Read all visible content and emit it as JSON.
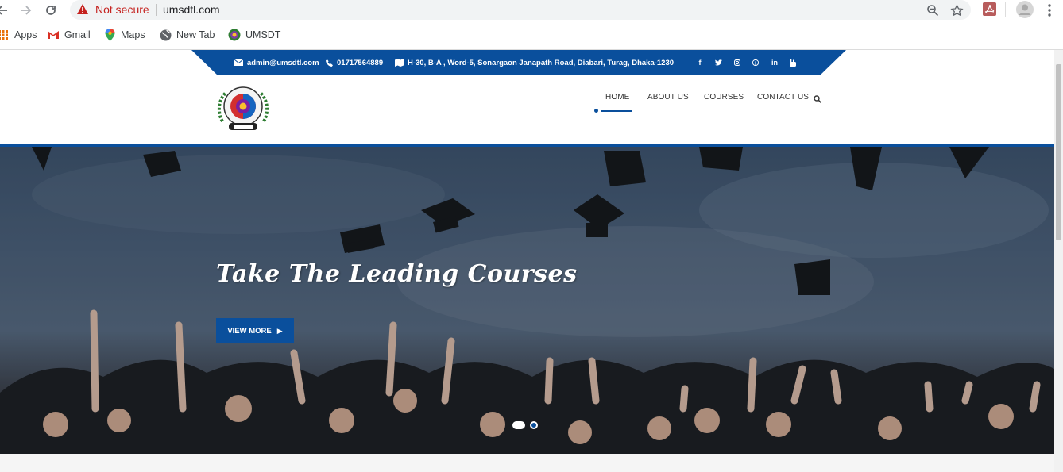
{
  "browser": {
    "security_label": "Not secure",
    "url": "umsdtl.com",
    "bookmarks": [
      {
        "label": "Apps",
        "icon": "apps-grid-icon"
      },
      {
        "label": "Gmail",
        "icon": "gmail-icon"
      },
      {
        "label": "Maps",
        "icon": "maps-pin-icon"
      },
      {
        "label": "New Tab",
        "icon": "globe-icon"
      },
      {
        "label": "UMSDT",
        "icon": "umsdt-favicon"
      }
    ]
  },
  "topbar": {
    "email": "admin@umsdtl.com",
    "phone": "01717564889",
    "address": "H-30, B-A , Word-5, Sonargaon Janapath Road, Diabari, Turag, Dhaka-1230",
    "social": [
      "facebook-icon",
      "twitter-icon",
      "instagram-icon",
      "pinterest-icon",
      "linkedin-icon",
      "youtube-icon"
    ]
  },
  "menu": {
    "items": [
      "HOME",
      "ABOUT US",
      "COURSES",
      "CONTACT US"
    ],
    "active": "HOME"
  },
  "hero": {
    "title": "Take The Leading Courses",
    "button_label": "VIEW MORE",
    "slides": 2,
    "active_slide": 1
  },
  "colors": {
    "brand_blue": "#0a4f9c",
    "warning_red": "#c5221f"
  }
}
